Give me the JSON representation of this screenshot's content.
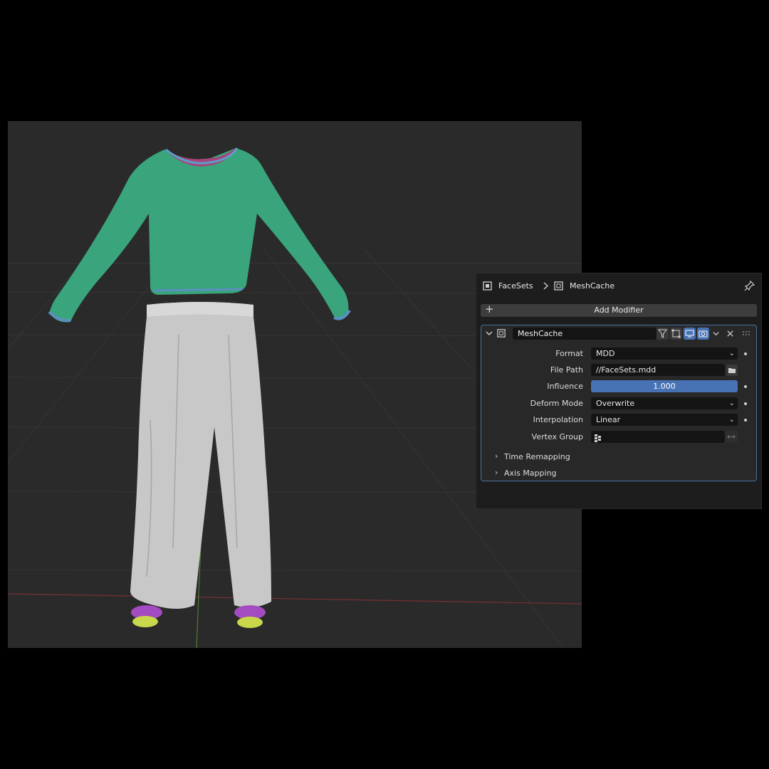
{
  "breadcrumb": {
    "object": "FaceSets",
    "modifier": "MeshCache"
  },
  "icons": [
    "object-icon",
    "chevron-right-icon",
    "modifier-icon",
    "pin-icon",
    "plus-icon",
    "expand-icon",
    "filter-icon",
    "editmode-icon",
    "monitor-icon",
    "camera-icon",
    "close-icon",
    "drag-handle-icon",
    "folder-icon",
    "vertex-group-icon",
    "swap-icon"
  ],
  "add_modifier_label": "Add Modifier",
  "modifier": {
    "name": "MeshCache",
    "fields": {
      "format_label": "Format",
      "format_value": "MDD",
      "filepath_label": "File Path",
      "filepath_value": "//FaceSets.mdd",
      "influence_label": "Influence",
      "influence_value": "1.000",
      "deform_label": "Deform Mode",
      "deform_value": "Overwrite",
      "interp_label": "Interpolation",
      "interp_value": "Linear",
      "vgroup_label": "Vertex Group",
      "vgroup_value": ""
    },
    "subpanels": {
      "time": "Time Remapping",
      "axis": "Axis Mapping"
    }
  },
  "colors": {
    "accent": "#4772b3",
    "viewport_bg": "#2a2a2a",
    "shirt": "#3aa57c",
    "pants": "#c8c8c8",
    "socks_top": "#a34bc0",
    "socks_bottom": "#c9d84a"
  }
}
